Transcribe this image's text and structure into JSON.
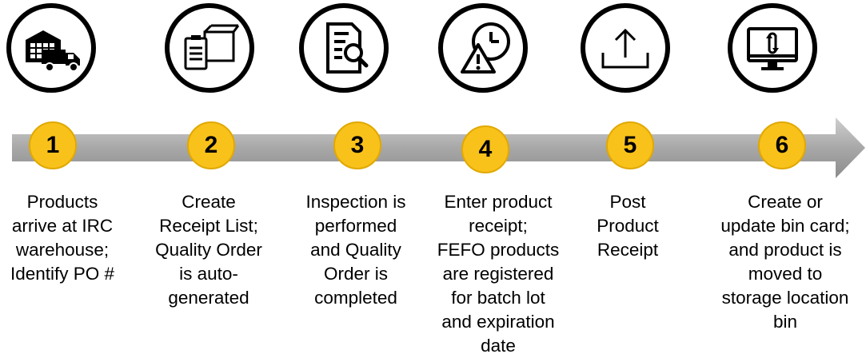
{
  "steps": [
    {
      "number": "1",
      "icon": "warehouse-truck-icon",
      "text": "Products\narrive at IRC\nwarehouse;\nIdentify PO #"
    },
    {
      "number": "2",
      "icon": "clipboard-box-icon",
      "text": "Create\nReceipt List;\nQuality Order\nis auto-\ngenerated"
    },
    {
      "number": "3",
      "icon": "document-search-icon",
      "text": "Inspection is\nperformed\nand Quality\nOrder is\ncompleted"
    },
    {
      "number": "4",
      "icon": "clock-warning-icon",
      "text": "Enter product\nreceipt;\nFEFO products\nare registered\nfor batch lot\nand expiration\ndate"
    },
    {
      "number": "5",
      "icon": "upload-icon",
      "text": "Post\nProduct\nReceipt"
    },
    {
      "number": "6",
      "icon": "monitor-refresh-icon",
      "text": "Create or\nupdate bin card;\nand product is\nmoved to\nstorage location\nbin"
    }
  ],
  "colors": {
    "badge": "#f9c21b",
    "arrow": "#a6a6a6",
    "outline": "#000000"
  }
}
